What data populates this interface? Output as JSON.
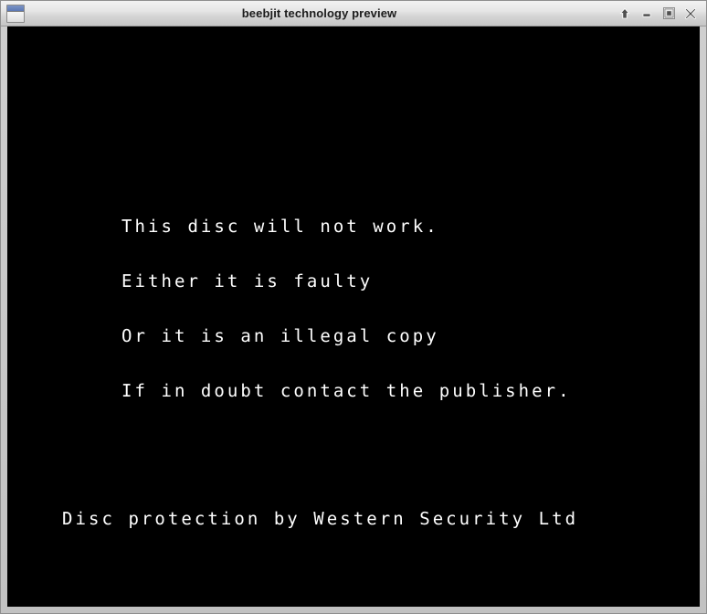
{
  "window": {
    "title": "beebjit technology preview",
    "icon": "window-icon",
    "buttons": [
      {
        "name": "shade-button",
        "icon": "up-arrow-icon"
      },
      {
        "name": "minimize-button",
        "icon": "minimize-icon"
      },
      {
        "name": "maximize-button",
        "icon": "maximize-icon"
      },
      {
        "name": "close-button",
        "icon": "close-icon"
      }
    ]
  },
  "screen": {
    "background_color": "#000000",
    "text_color": "#ffffff",
    "message_lines": [
      "This disc will not work.",
      "Either it is faulty",
      "Or it is an illegal copy",
      "If in doubt contact the publisher."
    ],
    "footer_line": "Disc protection by Western Security Ltd"
  }
}
